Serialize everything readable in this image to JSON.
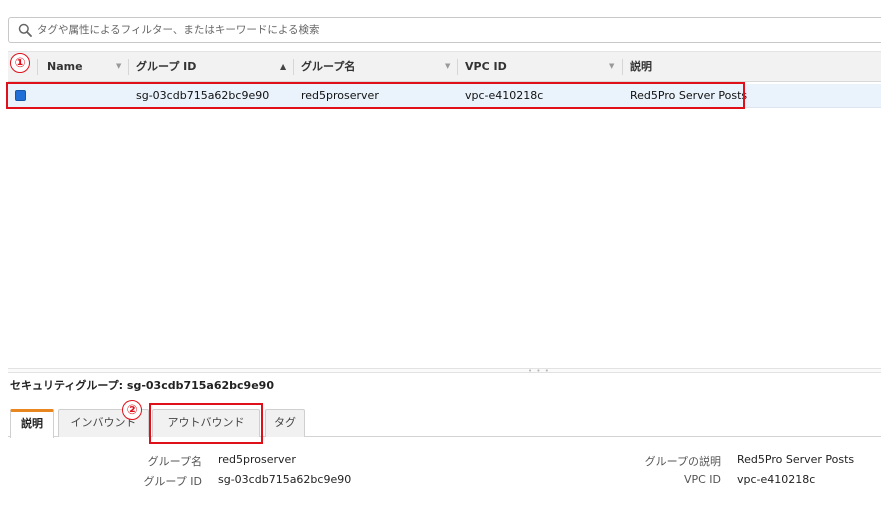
{
  "search": {
    "placeholder": "タグや属性によるフィルター、またはキーワードによる検索"
  },
  "table": {
    "columns": [
      "Name",
      "グループ ID",
      "グループ名",
      "VPC ID",
      "説明"
    ],
    "rows": [
      {
        "name": "",
        "group_id": "sg-03cdb715a62bc9e90",
        "group_name": "red5proserver",
        "vpc_id": "vpc-e410218c",
        "description": "Red5Pro Server Posts"
      }
    ]
  },
  "annotations": {
    "marker1": "①",
    "marker2": "②"
  },
  "detail": {
    "title": "セキュリティグループ: sg-03cdb715a62bc9e90",
    "tabs": [
      "説明",
      "インバウンド",
      "アウトバウンド",
      "タグ"
    ],
    "active_tab": "説明",
    "fields_left": [
      {
        "label": "グループ名",
        "value": "red5proserver"
      },
      {
        "label": "グループ ID",
        "value": "sg-03cdb715a62bc9e90"
      }
    ],
    "fields_right": [
      {
        "label": "グループの説明",
        "value": "Red5Pro Server Posts"
      },
      {
        "label": "VPC ID",
        "value": "vpc-e410218c"
      }
    ]
  },
  "colors": {
    "accent": "#e8861f",
    "highlight": "#e0101a",
    "selected_row": "#eaf2fc",
    "checkbox": "#1f6fd6"
  },
  "icons": [
    "search-icon",
    "sort-asc-icon",
    "sort-desc-icon",
    "splitter-grip-icon"
  ]
}
